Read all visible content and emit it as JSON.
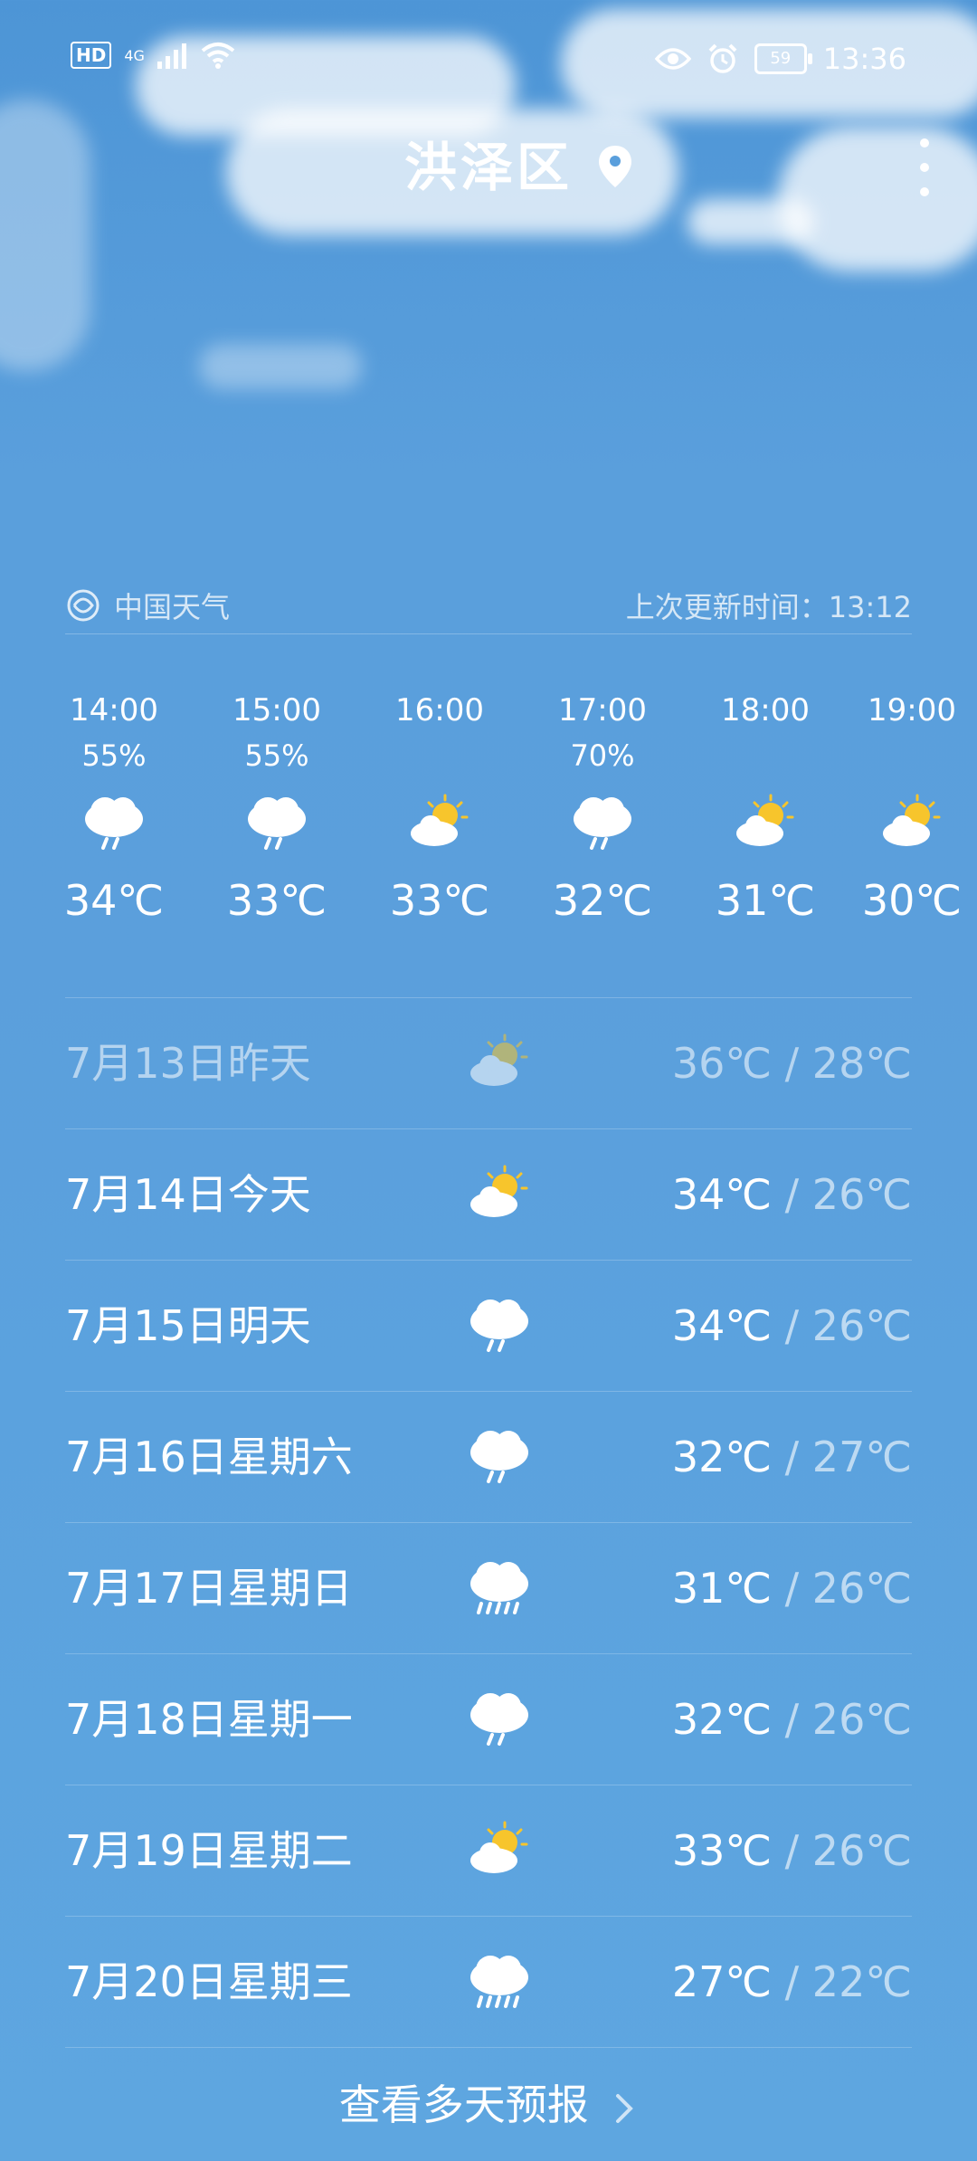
{
  "status_bar": {
    "hd_label": "HD",
    "network_label": "4G",
    "battery_level": "59",
    "time": "13:36"
  },
  "header": {
    "city": "洪泽区",
    "location_icon": "location-pin-icon",
    "menu_icon": "more-vert-icon"
  },
  "source": {
    "name": "中国天气",
    "updated": "上次更新时间：13:12"
  },
  "hourly": [
    {
      "time": "14:00",
      "prob": "55%",
      "icon": "rain-icon",
      "temp": "34℃"
    },
    {
      "time": "15:00",
      "prob": "55%",
      "icon": "rain-icon",
      "temp": "33℃"
    },
    {
      "time": "16:00",
      "prob": "",
      "icon": "partly-cloudy-icon",
      "temp": "33℃"
    },
    {
      "time": "17:00",
      "prob": "70%",
      "icon": "rain-icon",
      "temp": "32℃"
    },
    {
      "time": "18:00",
      "prob": "",
      "icon": "partly-cloudy-icon",
      "temp": "31℃"
    },
    {
      "time": "19:00",
      "prob": "",
      "icon": "partly-cloudy-icon",
      "temp": "30℃"
    }
  ],
  "daily": [
    {
      "label": "7月13日昨天",
      "icon": "partly-cloudy-icon",
      "high": "36℃",
      "sep": " / ",
      "low": "28℃"
    },
    {
      "label": "7月14日今天",
      "icon": "partly-cloudy-icon",
      "high": "34℃",
      "sep": " / ",
      "low": "26℃"
    },
    {
      "label": "7月15日明天",
      "icon": "rain-icon",
      "high": "34℃",
      "sep": " / ",
      "low": "26℃"
    },
    {
      "label": "7月16日星期六",
      "icon": "rain-icon",
      "high": "32℃",
      "sep": " / ",
      "low": "27℃"
    },
    {
      "label": "7月17日星期日",
      "icon": "heavy-rain-icon",
      "high": "31℃",
      "sep": " / ",
      "low": "26℃"
    },
    {
      "label": "7月18日星期一",
      "icon": "rain-icon",
      "high": "32℃",
      "sep": " / ",
      "low": "26℃"
    },
    {
      "label": "7月19日星期二",
      "icon": "partly-cloudy-icon",
      "high": "33℃",
      "sep": " / ",
      "low": "26℃"
    },
    {
      "label": "7月20日星期三",
      "icon": "heavy-rain-icon",
      "high": "27℃",
      "sep": " / ",
      "low": "22℃"
    }
  ],
  "more_forecast": "查看多天预报"
}
